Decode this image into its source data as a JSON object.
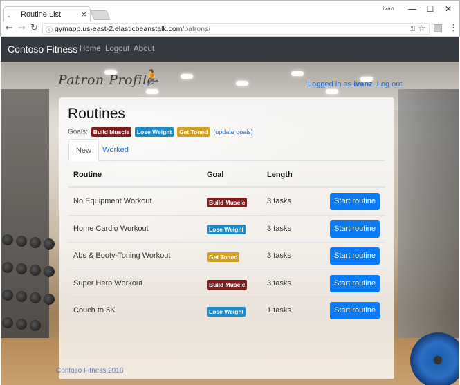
{
  "browser": {
    "tab_title": "Routine List",
    "tab_favicon": "̱̱",
    "tab_close": "×",
    "user_chip": "ivan",
    "minimize": "—",
    "maximize": "☐",
    "close": "✕",
    "back_icon": "←",
    "forward_icon": "→",
    "reload_icon": "↻",
    "lock_icon": "ⓘ",
    "url_host": "gymapp.us-east-2.elasticbeanstalk.com",
    "url_path": "/patrons/",
    "key_icon": "⚿",
    "star_icon": "☆",
    "menu_icon": "⋮"
  },
  "navbar": {
    "brand": "Contoso Fitness",
    "links": [
      "Home",
      "Logout",
      "About"
    ]
  },
  "header": {
    "profile_title": "Patron Profile",
    "runner_icon": "🏃",
    "logged_in_prefix": "Logged in as",
    "username": "ivanz",
    "logout_text": "Log out."
  },
  "card": {
    "title": "Routines",
    "goals_label": "Goals:",
    "goals": [
      "Build Muscle",
      "Lose Weight",
      "Get Toned"
    ],
    "update_goals": "(update goals)",
    "tabs": [
      "New",
      "Worked"
    ]
  },
  "table": {
    "headers": [
      "Routine",
      "Goal",
      "Length"
    ],
    "rows": [
      {
        "name": "No Equipment Workout",
        "goal": "Build Muscle",
        "length": "3 tasks",
        "action": "Start routine"
      },
      {
        "name": "Home Cardio Workout",
        "goal": "Lose Weight",
        "length": "3 tasks",
        "action": "Start routine"
      },
      {
        "name": "Abs & Booty-Toning Workout",
        "goal": "Get Toned",
        "length": "3 tasks",
        "action": "Start routine"
      },
      {
        "name": "Super Hero Workout",
        "goal": "Build Muscle",
        "length": "3 tasks",
        "action": "Start routine"
      },
      {
        "name": "Couch to 5K",
        "goal": "Lose Weight",
        "length": "1 tasks",
        "action": "Start routine"
      }
    ]
  },
  "footer": {
    "text": "Contoso Fitness 2018"
  },
  "colors": {
    "navbar": "#343a40",
    "primary_button": "#0a7bf6",
    "build_muscle": "#7f1d1d",
    "lose_weight": "#1c8ac4",
    "get_toned": "#d4a020",
    "link": "#1d6dd6"
  }
}
